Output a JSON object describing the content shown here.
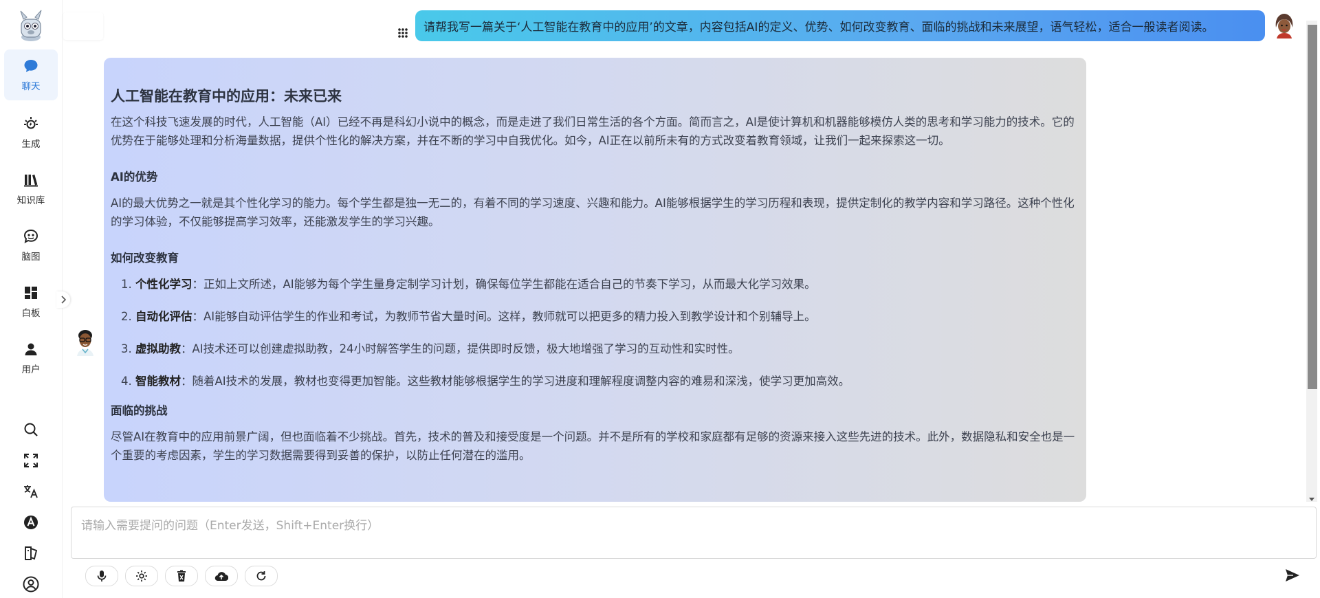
{
  "sidebar": {
    "logo": "robot-mascot-logo",
    "nav": [
      {
        "label": "聊天",
        "icon": "chat-bubble-icon",
        "active": true
      },
      {
        "label": "生成",
        "icon": "generate-spark-icon",
        "active": false
      },
      {
        "label": "知识库",
        "icon": "books-icon",
        "active": false
      },
      {
        "label": "脑图",
        "icon": "brain-icon",
        "active": false
      },
      {
        "label": "白板",
        "icon": "dashboard-icon",
        "active": false
      },
      {
        "label": "用户",
        "icon": "user-icon",
        "active": false
      }
    ],
    "tools": [
      "search-icon",
      "fullscreen-icon",
      "translate-icon",
      "font-a-icon",
      "book-edit-icon",
      "account-circle-icon"
    ]
  },
  "colors": {
    "accent": "#2f7bd8",
    "bubble_start": "#49c9ea",
    "bubble_end": "#4a8ff0",
    "card_start": "#c8d4fc",
    "card_end": "#dddddd"
  },
  "chat": {
    "user_message": "请帮我写一篇关于‘人工智能在教育中的应用’的文章，内容包括AI的定义、优势、如何改变教育、面临的挑战和未来展望，语气轻松，适合一般读者阅读。",
    "answer": {
      "title": "人工智能在教育中的应用：未来已来",
      "intro": "在这个科技飞速发展的时代，人工智能（AI）已经不再是科幻小说中的概念，而是走进了我们日常生活的各个方面。简而言之，AI是使计算机和机器能够模仿人类的思考和学习能力的技术。它的优势在于能够处理和分析海量数据，提供个性化的解决方案，并在不断的学习中自我优化。如今，AI正在以前所未有的方式改变着教育领域，让我们一起来探索这一切。",
      "section1_title": "AI的优势",
      "section1_text": "AI的最大优势之一就是其个性化学习的能力。每个学生都是独一无二的，有着不同的学习速度、兴趣和能力。AI能够根据学生的学习历程和表现，提供定制化的教学内容和学习路径。这种个性化的学习体验，不仅能够提高学习效率，还能激发学生的学习兴趣。",
      "section2_title": "如何改变教育",
      "items": [
        {
          "term": "个性化学习",
          "text": "：正如上文所述，AI能够为每个学生量身定制学习计划，确保每位学生都能在适合自己的节奏下学习，从而最大化学习效果。"
        },
        {
          "term": "自动化评估",
          "text": "：AI能够自动评估学生的作业和考试，为教师节省大量时间。这样，教师就可以把更多的精力投入到教学设计和个别辅导上。"
        },
        {
          "term": "虚拟助教",
          "text": "：AI技术还可以创建虚拟助教，24小时解答学生的问题，提供即时反馈，极大地增强了学习的互动性和实时性。"
        },
        {
          "term": "智能教材",
          "text": "：随着AI技术的发展，教材也变得更加智能。这些教材能够根据学生的学习进度和理解程度调整内容的难易和深浅，使学习更加高效。"
        }
      ],
      "section3_title": "面临的挑战",
      "section3_text": "尽管AI在教育中的应用前景广阔，但也面临着不少挑战。首先，技术的普及和接受度是一个问题。并不是所有的学校和家庭都有足够的资源来接入这些先进的技术。此外，数据隐私和安全也是一个重要的考虑因素，学生的学习数据需要得到妥善的保护，以防止任何潜在的滥用。"
    }
  },
  "input": {
    "placeholder": "请输入需要提问的问题（Enter发送，Shift+Enter换行）",
    "value": ""
  },
  "toolbar": {
    "buttons": [
      "microphone-icon",
      "settings-gear-icon",
      "delete-trash-icon",
      "cloud-upload-icon",
      "refresh-icon"
    ],
    "send": "send-icon"
  }
}
